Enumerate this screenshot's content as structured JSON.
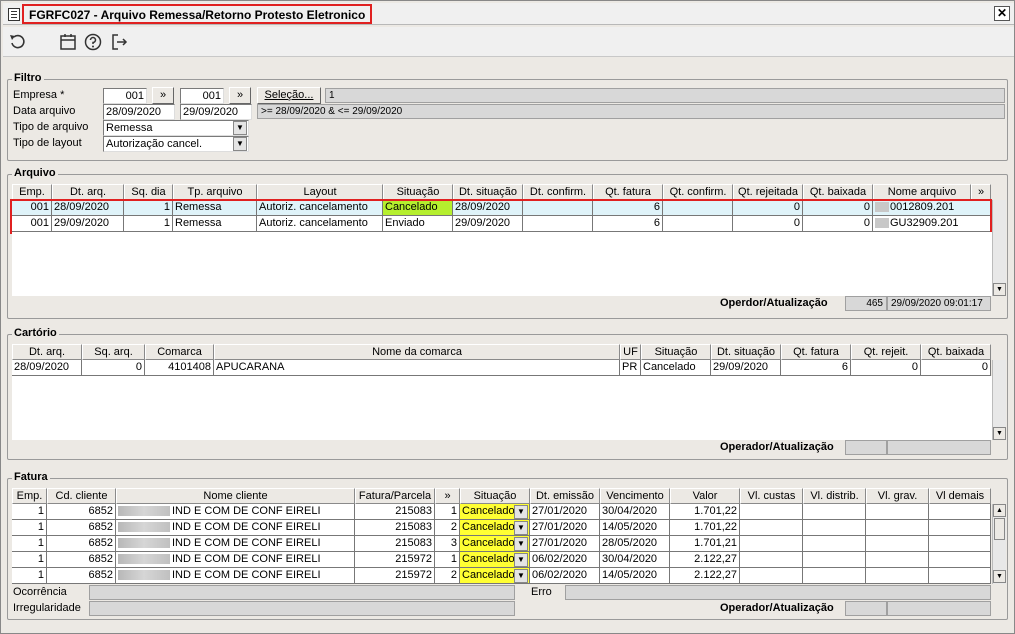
{
  "window": {
    "title": "FGRFC027 - Arquivo Remessa/Retorno Protesto Eletronico",
    "close_label": "✕"
  },
  "toolbar": {
    "icons": [
      "undo-icon",
      "calendar-icon",
      "help-icon",
      "exit-icon"
    ]
  },
  "filtro": {
    "title": "Filtro",
    "empresa_label": "Empresa *",
    "empresa_from": "001",
    "empresa_to": "001",
    "arrow_label": "»",
    "selecao_label": "Seleção...",
    "selecao_value": "1",
    "data_label": "Data arquivo",
    "data_from": "28/09/2020",
    "data_to": "29/09/2020",
    "data_expr": ">= 28/09/2020  &  <= 29/09/2020",
    "tipo_arquivo_label": "Tipo de arquivo",
    "tipo_arquivo_value": "Remessa",
    "tipo_layout_label": "Tipo de layout",
    "tipo_layout_value": "Autorização cancel."
  },
  "arquivo": {
    "title": "Arquivo",
    "columns": [
      "Emp.",
      "Dt. arq.",
      "Sq. dia",
      "Tp. arquivo",
      "Layout",
      "Situação",
      "Dt. situação",
      "Dt. confirm.",
      "Qt. fatura",
      "Qt. confirm.",
      "Qt. rejeitada",
      "Qt. baixada",
      "Nome arquivo",
      "»"
    ],
    "rows": [
      [
        "001",
        "28/09/2020",
        "1",
        "Remessa",
        "Autoriz. cancelamento",
        "Cancelado",
        "28/09/2020",
        "",
        "6",
        "",
        "0",
        "0",
        "0012809.201"
      ],
      [
        "001",
        "29/09/2020",
        "1",
        "Remessa",
        "Autoriz. cancelamento",
        "Enviado",
        "29/09/2020",
        "",
        "6",
        "",
        "0",
        "0",
        "GU32909.201"
      ]
    ],
    "operador_label": "Operdor/Atualização",
    "operador_code": "465",
    "operador_datetime": "29/09/2020 09:01:17"
  },
  "cartorio": {
    "title": "Cartório",
    "columns": [
      "Dt. arq.",
      "Sq. arq.",
      "Comarca",
      "Nome da comarca",
      "UF",
      "Situação",
      "Dt. situação",
      "Qt. fatura",
      "Qt. rejeit.",
      "Qt. baixada"
    ],
    "rows": [
      [
        "28/09/2020",
        "0",
        "4101408",
        "APUCARANA",
        "PR",
        "Cancelado",
        "29/09/2020",
        "6",
        "0",
        "0"
      ]
    ],
    "operador_label": "Operador/Atualização"
  },
  "fatura": {
    "title": "Fatura",
    "columns": [
      "Emp.",
      "Cd. cliente",
      "Nome cliente",
      "Fatura/Parcela",
      "»",
      "Situação",
      "Dt. emissão",
      "Vencimento",
      "Valor",
      "Vl. custas",
      "Vl. distrib.",
      "Vl. grav.",
      "Vl demais"
    ],
    "rows": [
      [
        "1",
        "6852",
        "IND E COM DE CONF EIRELI",
        "215083",
        "1",
        "Cancelado",
        "27/01/2020",
        "30/04/2020",
        "1.701,22"
      ],
      [
        "1",
        "6852",
        "IND E COM DE CONF EIRELI",
        "215083",
        "2",
        "Cancelado",
        "27/01/2020",
        "14/05/2020",
        "1.701,22"
      ],
      [
        "1",
        "6852",
        "IND E COM DE CONF EIRELI",
        "215083",
        "3",
        "Cancelado",
        "27/01/2020",
        "28/05/2020",
        "1.701,21"
      ],
      [
        "1",
        "6852",
        "IND E COM DE CONF EIRELI",
        "215972",
        "1",
        "Cancelado",
        "06/02/2020",
        "30/04/2020",
        "2.122,27"
      ],
      [
        "1",
        "6852",
        "IND E COM DE CONF EIRELI",
        "215972",
        "2",
        "Cancelado",
        "06/02/2020",
        "14/05/2020",
        "2.122,27"
      ]
    ],
    "ocorrencia_label": "Ocorrência",
    "irregularidade_label": "Irregularidade",
    "erro_label": "Erro",
    "operador_label": "Operador/Atualização"
  }
}
